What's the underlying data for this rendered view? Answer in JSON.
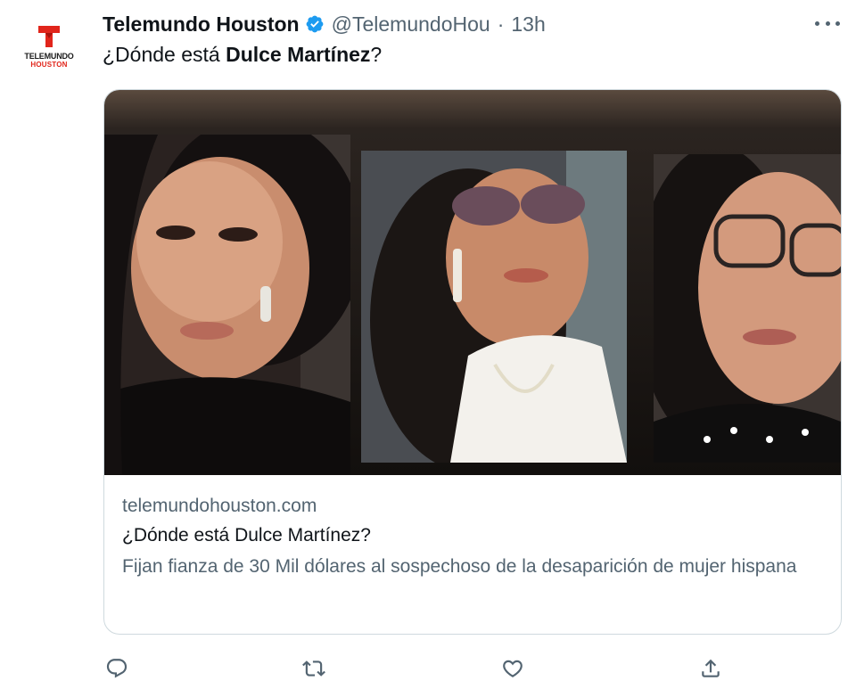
{
  "author": {
    "display_name": "Telemundo Houston",
    "handle": "@TelemundoHou",
    "separator": "·",
    "time": "13h",
    "verified": true,
    "avatar": {
      "brand_text": "TELEMUNDO",
      "brand_sub": "HOUSTON",
      "accent_color": "#e1251b"
    }
  },
  "tweet": {
    "text_prefix": "¿Dónde está ",
    "text_bold": "Dulce Martínez",
    "text_suffix": "?"
  },
  "card": {
    "domain": "telemundohouston.com",
    "title": "¿Dónde está Dulce Martínez?",
    "description": "Fijan fianza de 30 Mil dólares al sospechoso de la desaparición de mujer hispana"
  },
  "actions": {
    "reply_icon": "reply-icon",
    "retweet_icon": "retweet-icon",
    "like_icon": "heart-icon",
    "share_icon": "share-icon"
  },
  "colors": {
    "text_primary": "#0f1419",
    "text_secondary": "#536471",
    "border": "#cfd9de",
    "verified_blue": "#1d9bf0"
  }
}
